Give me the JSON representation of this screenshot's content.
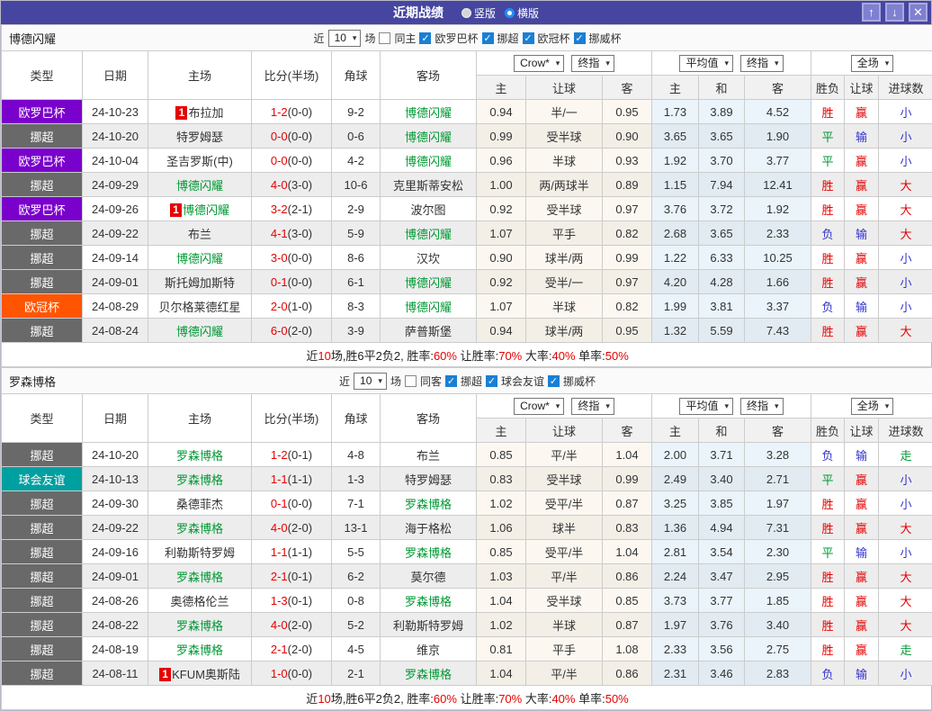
{
  "titlebar": {
    "title": "近期战绩",
    "radios": [
      {
        "label": "竖版",
        "selected": false
      },
      {
        "label": "横版",
        "selected": true
      }
    ]
  },
  "icons": {
    "up": "↑",
    "down": "↓",
    "close": "✕",
    "caret": "▾",
    "check": "✓"
  },
  "colors": {
    "title_bar": "#4646a0",
    "league": {
      "欧罗巴杯": "#7a00cc",
      "挪超": "#696969",
      "欧冠杯": "#ff5500",
      "球会友谊": "#00a0a0"
    },
    "result": {
      "胜": "#e60000",
      "平": "#009933",
      "负": "#3333cc",
      "赢": "#e60000",
      "输": "#3333cc",
      "大": "#e60000",
      "小": "#3333cc",
      "走": "#009933"
    },
    "self_team": "#009933",
    "score_ft": "#e60000"
  },
  "header": {
    "cols": [
      "类型",
      "日期",
      "主场",
      "比分(半场)",
      "角球",
      "客场"
    ],
    "ah_group": {
      "select1": "Crow*",
      "select2": "终指",
      "cols": [
        "主",
        "让球",
        "客"
      ]
    },
    "eu_group": {
      "select1": "平均值",
      "select2": "终指",
      "cols": [
        "主",
        "和",
        "客"
      ]
    },
    "res_group": {
      "select1": "全场",
      "cols": [
        "胜负",
        "让球",
        "进球数"
      ]
    }
  },
  "sections": [
    {
      "team": "博德闪耀",
      "filter": {
        "near_label": "近",
        "near_value": "10",
        "games_label": "场",
        "same_label": "同主",
        "same_checked": false,
        "cups": [
          {
            "label": "欧罗巴杯",
            "checked": true
          },
          {
            "label": "挪超",
            "checked": true
          },
          {
            "label": "欧冠杯",
            "checked": true
          },
          {
            "label": "挪威杯",
            "checked": true
          }
        ]
      },
      "rows": [
        {
          "league": "欧罗巴杯",
          "date": "24-10-23",
          "home": {
            "badge": "1",
            "name": "布拉加",
            "self": false
          },
          "score": {
            "ft": "1-2",
            "ht": "(0-0)"
          },
          "corners": "9-2",
          "away": {
            "badge": "",
            "name": "博德闪耀",
            "self": true
          },
          "ah": [
            "0.94",
            "半/一",
            "0.95"
          ],
          "eu": [
            "1.73",
            "3.89",
            "4.52"
          ],
          "res": [
            "胜",
            "赢",
            "小"
          ]
        },
        {
          "league": "挪超",
          "date": "24-10-20",
          "home": {
            "badge": "",
            "name": "特罗姆瑟",
            "self": false
          },
          "score": {
            "ft": "0-0",
            "ht": "(0-0)"
          },
          "corners": "0-6",
          "away": {
            "badge": "",
            "name": "博德闪耀",
            "self": true
          },
          "ah": [
            "0.99",
            "受半球",
            "0.90"
          ],
          "eu": [
            "3.65",
            "3.65",
            "1.90"
          ],
          "res": [
            "平",
            "输",
            "小"
          ]
        },
        {
          "league": "欧罗巴杯",
          "date": "24-10-04",
          "home": {
            "badge": "",
            "name": "圣吉罗斯(中)",
            "self": false
          },
          "score": {
            "ft": "0-0",
            "ht": "(0-0)"
          },
          "corners": "4-2",
          "away": {
            "badge": "",
            "name": "博德闪耀",
            "self": true
          },
          "ah": [
            "0.96",
            "半球",
            "0.93"
          ],
          "eu": [
            "1.92",
            "3.70",
            "3.77"
          ],
          "res": [
            "平",
            "赢",
            "小"
          ]
        },
        {
          "league": "挪超",
          "date": "24-09-29",
          "home": {
            "badge": "",
            "name": "博德闪耀",
            "self": true
          },
          "score": {
            "ft": "4-0",
            "ht": "(3-0)"
          },
          "corners": "10-6",
          "away": {
            "badge": "",
            "name": "克里斯蒂安松",
            "self": false
          },
          "ah": [
            "1.00",
            "两/两球半",
            "0.89"
          ],
          "eu": [
            "1.15",
            "7.94",
            "12.41"
          ],
          "res": [
            "胜",
            "赢",
            "大"
          ]
        },
        {
          "league": "欧罗巴杯",
          "date": "24-09-26",
          "home": {
            "badge": "1",
            "name": "博德闪耀",
            "self": true
          },
          "score": {
            "ft": "3-2",
            "ht": "(2-1)"
          },
          "corners": "2-9",
          "away": {
            "badge": "",
            "name": "波尔图",
            "self": false
          },
          "ah": [
            "0.92",
            "受半球",
            "0.97"
          ],
          "eu": [
            "3.76",
            "3.72",
            "1.92"
          ],
          "res": [
            "胜",
            "赢",
            "大"
          ]
        },
        {
          "league": "挪超",
          "date": "24-09-22",
          "home": {
            "badge": "",
            "name": "布兰",
            "self": false
          },
          "score": {
            "ft": "4-1",
            "ht": "(3-0)"
          },
          "corners": "5-9",
          "away": {
            "badge": "",
            "name": "博德闪耀",
            "self": true
          },
          "ah": [
            "1.07",
            "平手",
            "0.82"
          ],
          "eu": [
            "2.68",
            "3.65",
            "2.33"
          ],
          "res": [
            "负",
            "输",
            "大"
          ]
        },
        {
          "league": "挪超",
          "date": "24-09-14",
          "home": {
            "badge": "",
            "name": "博德闪耀",
            "self": true
          },
          "score": {
            "ft": "3-0",
            "ht": "(0-0)"
          },
          "corners": "8-6",
          "away": {
            "badge": "",
            "name": "汉坎",
            "self": false
          },
          "ah": [
            "0.90",
            "球半/两",
            "0.99"
          ],
          "eu": [
            "1.22",
            "6.33",
            "10.25"
          ],
          "res": [
            "胜",
            "赢",
            "小"
          ]
        },
        {
          "league": "挪超",
          "date": "24-09-01",
          "home": {
            "badge": "",
            "name": "斯托姆加斯特",
            "self": false
          },
          "score": {
            "ft": "0-1",
            "ht": "(0-0)"
          },
          "corners": "6-1",
          "away": {
            "badge": "",
            "name": "博德闪耀",
            "self": true
          },
          "ah": [
            "0.92",
            "受半/一",
            "0.97"
          ],
          "eu": [
            "4.20",
            "4.28",
            "1.66"
          ],
          "res": [
            "胜",
            "赢",
            "小"
          ]
        },
        {
          "league": "欧冠杯",
          "date": "24-08-29",
          "home": {
            "badge": "",
            "name": "贝尔格莱德红星",
            "self": false
          },
          "score": {
            "ft": "2-0",
            "ht": "(1-0)"
          },
          "corners": "8-3",
          "away": {
            "badge": "",
            "name": "博德闪耀",
            "self": true
          },
          "ah": [
            "1.07",
            "半球",
            "0.82"
          ],
          "eu": [
            "1.99",
            "3.81",
            "3.37"
          ],
          "res": [
            "负",
            "输",
            "小"
          ]
        },
        {
          "league": "挪超",
          "date": "24-08-24",
          "home": {
            "badge": "",
            "name": "博德闪耀",
            "self": true
          },
          "score": {
            "ft": "6-0",
            "ht": "(2-0)"
          },
          "corners": "3-9",
          "away": {
            "badge": "",
            "name": "萨普斯堡",
            "self": false
          },
          "ah": [
            "0.94",
            "球半/两",
            "0.95"
          ],
          "eu": [
            "1.32",
            "5.59",
            "7.43"
          ],
          "res": [
            "胜",
            "赢",
            "大"
          ]
        }
      ],
      "summary": [
        {
          "t": "近"
        },
        {
          "t": "10",
          "red": true
        },
        {
          "t": "场,胜6平2负2, 胜率:"
        },
        {
          "t": "60%",
          "red": true
        },
        {
          "t": " 让胜率:"
        },
        {
          "t": "70%",
          "red": true
        },
        {
          "t": " 大率:"
        },
        {
          "t": "40%",
          "red": true
        },
        {
          "t": " 单率:"
        },
        {
          "t": "50%",
          "red": true
        }
      ]
    },
    {
      "team": "罗森博格",
      "filter": {
        "near_label": "近",
        "near_value": "10",
        "games_label": "场",
        "same_label": "同客",
        "same_checked": false,
        "cups": [
          {
            "label": "挪超",
            "checked": true
          },
          {
            "label": "球会友谊",
            "checked": true
          },
          {
            "label": "挪威杯",
            "checked": true
          }
        ]
      },
      "rows": [
        {
          "league": "挪超",
          "date": "24-10-20",
          "home": {
            "badge": "",
            "name": "罗森博格",
            "self": true
          },
          "score": {
            "ft": "1-2",
            "ht": "(0-1)"
          },
          "corners": "4-8",
          "away": {
            "badge": "",
            "name": "布兰",
            "self": false
          },
          "ah": [
            "0.85",
            "平/半",
            "1.04"
          ],
          "eu": [
            "2.00",
            "3.71",
            "3.28"
          ],
          "res": [
            "负",
            "输",
            "走"
          ]
        },
        {
          "league": "球会友谊",
          "date": "24-10-13",
          "home": {
            "badge": "",
            "name": "罗森博格",
            "self": true
          },
          "score": {
            "ft": "1-1",
            "ht": "(1-1)"
          },
          "corners": "1-3",
          "away": {
            "badge": "",
            "name": "特罗姆瑟",
            "self": false
          },
          "ah": [
            "0.83",
            "受半球",
            "0.99"
          ],
          "eu": [
            "2.49",
            "3.40",
            "2.71"
          ],
          "res": [
            "平",
            "赢",
            "小"
          ]
        },
        {
          "league": "挪超",
          "date": "24-09-30",
          "home": {
            "badge": "",
            "name": "桑德菲杰",
            "self": false
          },
          "score": {
            "ft": "0-1",
            "ht": "(0-0)"
          },
          "corners": "7-1",
          "away": {
            "badge": "",
            "name": "罗森博格",
            "self": true
          },
          "ah": [
            "1.02",
            "受平/半",
            "0.87"
          ],
          "eu": [
            "3.25",
            "3.85",
            "1.97"
          ],
          "res": [
            "胜",
            "赢",
            "小"
          ]
        },
        {
          "league": "挪超",
          "date": "24-09-22",
          "home": {
            "badge": "",
            "name": "罗森博格",
            "self": true
          },
          "score": {
            "ft": "4-0",
            "ht": "(2-0)"
          },
          "corners": "13-1",
          "away": {
            "badge": "",
            "name": "海于格松",
            "self": false
          },
          "ah": [
            "1.06",
            "球半",
            "0.83"
          ],
          "eu": [
            "1.36",
            "4.94",
            "7.31"
          ],
          "res": [
            "胜",
            "赢",
            "大"
          ]
        },
        {
          "league": "挪超",
          "date": "24-09-16",
          "home": {
            "badge": "",
            "name": "利勒斯特罗姆",
            "self": false
          },
          "score": {
            "ft": "1-1",
            "ht": "(1-1)"
          },
          "corners": "5-5",
          "away": {
            "badge": "",
            "name": "罗森博格",
            "self": true
          },
          "ah": [
            "0.85",
            "受平/半",
            "1.04"
          ],
          "eu": [
            "2.81",
            "3.54",
            "2.30"
          ],
          "res": [
            "平",
            "输",
            "小"
          ]
        },
        {
          "league": "挪超",
          "date": "24-09-01",
          "home": {
            "badge": "",
            "name": "罗森博格",
            "self": true
          },
          "score": {
            "ft": "2-1",
            "ht": "(0-1)"
          },
          "corners": "6-2",
          "away": {
            "badge": "",
            "name": "莫尔德",
            "self": false
          },
          "ah": [
            "1.03",
            "平/半",
            "0.86"
          ],
          "eu": [
            "2.24",
            "3.47",
            "2.95"
          ],
          "res": [
            "胜",
            "赢",
            "大"
          ]
        },
        {
          "league": "挪超",
          "date": "24-08-26",
          "home": {
            "badge": "",
            "name": "奥德格伦兰",
            "self": false
          },
          "score": {
            "ft": "1-3",
            "ht": "(0-1)"
          },
          "corners": "0-8",
          "away": {
            "badge": "",
            "name": "罗森博格",
            "self": true
          },
          "ah": [
            "1.04",
            "受半球",
            "0.85"
          ],
          "eu": [
            "3.73",
            "3.77",
            "1.85"
          ],
          "res": [
            "胜",
            "赢",
            "大"
          ]
        },
        {
          "league": "挪超",
          "date": "24-08-22",
          "home": {
            "badge": "",
            "name": "罗森博格",
            "self": true
          },
          "score": {
            "ft": "4-0",
            "ht": "(2-0)"
          },
          "corners": "5-2",
          "away": {
            "badge": "",
            "name": "利勒斯特罗姆",
            "self": false
          },
          "ah": [
            "1.02",
            "半球",
            "0.87"
          ],
          "eu": [
            "1.97",
            "3.76",
            "3.40"
          ],
          "res": [
            "胜",
            "赢",
            "大"
          ]
        },
        {
          "league": "挪超",
          "date": "24-08-19",
          "home": {
            "badge": "",
            "name": "罗森博格",
            "self": true
          },
          "score": {
            "ft": "2-1",
            "ht": "(2-0)"
          },
          "corners": "4-5",
          "away": {
            "badge": "",
            "name": "维京",
            "self": false
          },
          "ah": [
            "0.81",
            "平手",
            "1.08"
          ],
          "eu": [
            "2.33",
            "3.56",
            "2.75"
          ],
          "res": [
            "胜",
            "赢",
            "走"
          ]
        },
        {
          "league": "挪超",
          "date": "24-08-11",
          "home": {
            "badge": "1",
            "name": "KFUM奥斯陆",
            "self": false
          },
          "score": {
            "ft": "1-0",
            "ht": "(0-0)"
          },
          "corners": "2-1",
          "away": {
            "badge": "",
            "name": "罗森博格",
            "self": true
          },
          "ah": [
            "1.04",
            "平/半",
            "0.86"
          ],
          "eu": [
            "2.31",
            "3.46",
            "2.83"
          ],
          "res": [
            "负",
            "输",
            "小"
          ]
        }
      ],
      "summary": [
        {
          "t": "近"
        },
        {
          "t": "10",
          "red": true
        },
        {
          "t": "场,胜6平2负2, 胜率:"
        },
        {
          "t": "60%",
          "red": true
        },
        {
          "t": " 让胜率:"
        },
        {
          "t": "70%",
          "red": true
        },
        {
          "t": " 大率:"
        },
        {
          "t": "40%",
          "red": true
        },
        {
          "t": " 单率:"
        },
        {
          "t": "50%",
          "red": true
        }
      ]
    }
  ]
}
